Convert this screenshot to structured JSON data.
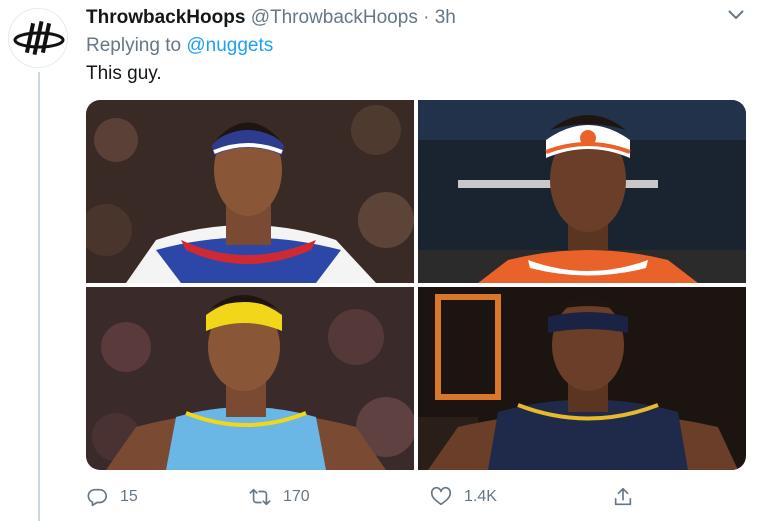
{
  "tweet": {
    "author_name": "ThrowbackHoops",
    "author_handle": "@ThrowbackHoops",
    "separator": "·",
    "time": "3h",
    "replying_prefix": "Replying to",
    "replying_to": "@nuggets",
    "text": "This guy."
  },
  "media": {
    "images": [
      {
        "jersey_color": "#cf2a33",
        "headband_color": "#2d3c8f",
        "team": "all-star-east"
      },
      {
        "jersey_color": "#e8622a",
        "headband_color": "#ffffff",
        "team": "knicks"
      },
      {
        "jersey_color": "#6ab6e4",
        "headband_color": "#f2d61a",
        "team": "nuggets-powder-blue"
      },
      {
        "jersey_color": "#1f2a4a",
        "headband_color": "#1a2344",
        "team": "nuggets-navy"
      }
    ]
  },
  "actions": {
    "reply": {
      "icon": "reply-icon",
      "count": "15"
    },
    "retweet": {
      "icon": "retweet-icon",
      "count": "170"
    },
    "like": {
      "icon": "heart-icon",
      "count": "1.4K"
    },
    "share": {
      "icon": "share-icon",
      "count": ""
    }
  },
  "colors": {
    "text": "#14171a",
    "secondary": "#657786",
    "link": "#1da1f2",
    "thread_line": "#ccd6dd"
  }
}
